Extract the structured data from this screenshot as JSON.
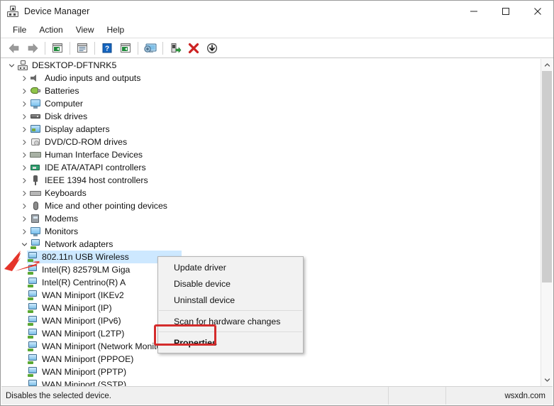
{
  "window": {
    "title": "Device Manager",
    "icon": "device-manager-icon",
    "minimize_label": "−",
    "maximize_label": "□",
    "close_label": "✕"
  },
  "menubar": {
    "items": [
      {
        "label": "File"
      },
      {
        "label": "Action"
      },
      {
        "label": "View"
      },
      {
        "label": "Help"
      }
    ]
  },
  "toolbar": {
    "buttons": [
      {
        "name": "back-icon",
        "title": "Back"
      },
      {
        "name": "forward-icon",
        "title": "Forward"
      },
      {
        "name": "properties-window-icon",
        "title": "Properties"
      },
      {
        "name": "show-hide-console-tree-icon",
        "title": "Show/Hide Console Tree"
      },
      {
        "name": "help-icon",
        "title": "Help"
      },
      {
        "name": "update-driver-icon",
        "title": "Update driver"
      },
      {
        "name": "scan-hardware-changes-icon",
        "title": "Scan for hardware changes"
      },
      {
        "name": "enable-device-icon",
        "title": "Enable device"
      },
      {
        "name": "uninstall-device-icon",
        "title": "Uninstall device"
      },
      {
        "name": "disable-device-icon",
        "title": "Disable device"
      }
    ]
  },
  "tree": {
    "root": {
      "label": "DESKTOP-DFTNRK5",
      "icon": "computer-root-icon",
      "expanded": true
    },
    "categories": [
      {
        "label": "Audio inputs and outputs",
        "icon": "speaker-icon",
        "expanded": false
      },
      {
        "label": "Batteries",
        "icon": "battery-icon",
        "expanded": false
      },
      {
        "label": "Computer",
        "icon": "computer-icon",
        "expanded": false
      },
      {
        "label": "Disk drives",
        "icon": "disk-drive-icon",
        "expanded": false
      },
      {
        "label": "Display adapters",
        "icon": "display-adapter-icon",
        "expanded": false
      },
      {
        "label": "DVD/CD-ROM drives",
        "icon": "dvd-drive-icon",
        "expanded": false
      },
      {
        "label": "Human Interface Devices",
        "icon": "hid-icon",
        "expanded": false
      },
      {
        "label": "IDE ATA/ATAPI controllers",
        "icon": "ide-controller-icon",
        "expanded": false
      },
      {
        "label": "IEEE 1394 host controllers",
        "icon": "ieee1394-icon",
        "expanded": false
      },
      {
        "label": "Keyboards",
        "icon": "keyboard-icon",
        "expanded": false
      },
      {
        "label": "Mice and other pointing devices",
        "icon": "mouse-icon",
        "expanded": false
      },
      {
        "label": "Modems",
        "icon": "modem-icon",
        "expanded": false
      },
      {
        "label": "Monitors",
        "icon": "monitor-icon",
        "expanded": false
      },
      {
        "label": "Network adapters",
        "icon": "network-adapter-icon",
        "expanded": true
      }
    ],
    "network_devices": [
      {
        "label": "802.11n USB Wireless",
        "icon": "network-device-icon",
        "selected": true
      },
      {
        "label": "Intel(R) 82579LM Giga",
        "icon": "network-device-icon",
        "selected": false
      },
      {
        "label": "Intel(R) Centrino(R) A",
        "icon": "network-device-icon",
        "selected": false
      },
      {
        "label": "WAN Miniport (IKEv2",
        "icon": "network-device-icon",
        "selected": false
      },
      {
        "label": "WAN Miniport (IP)",
        "icon": "network-device-icon",
        "selected": false
      },
      {
        "label": "WAN Miniport (IPv6)",
        "icon": "network-device-icon",
        "selected": false
      },
      {
        "label": "WAN Miniport (L2TP)",
        "icon": "network-device-icon",
        "selected": false
      },
      {
        "label": "WAN Miniport (Network Monitor)",
        "icon": "network-device-icon",
        "selected": false
      },
      {
        "label": "WAN Miniport (PPPOE)",
        "icon": "network-device-icon",
        "selected": false
      },
      {
        "label": "WAN Miniport (PPTP)",
        "icon": "network-device-icon",
        "selected": false
      },
      {
        "label": "WAN Miniport (SSTP)",
        "icon": "network-device-icon",
        "selected": false
      }
    ]
  },
  "context_menu": {
    "items": [
      {
        "label": "Update driver",
        "bold": false,
        "separator_after": false
      },
      {
        "label": "Disable device",
        "bold": false,
        "separator_after": false
      },
      {
        "label": "Uninstall device",
        "bold": false,
        "separator_after": true
      },
      {
        "label": "Scan for hardware changes",
        "bold": false,
        "separator_after": true
      },
      {
        "label": "Properties",
        "bold": true,
        "separator_after": false
      }
    ],
    "highlighted_item": "Properties"
  },
  "statusbar": {
    "message": "Disables the selected device.",
    "middle": "",
    "watermark": "wsxdn.com"
  },
  "annotations": {
    "arrow_color": "#e5342a",
    "highlight_color": "#d42c2c",
    "selection_color": "#cde8ff"
  },
  "scrollbar": {
    "up_arrow": "˄",
    "down_arrow": "˅"
  }
}
